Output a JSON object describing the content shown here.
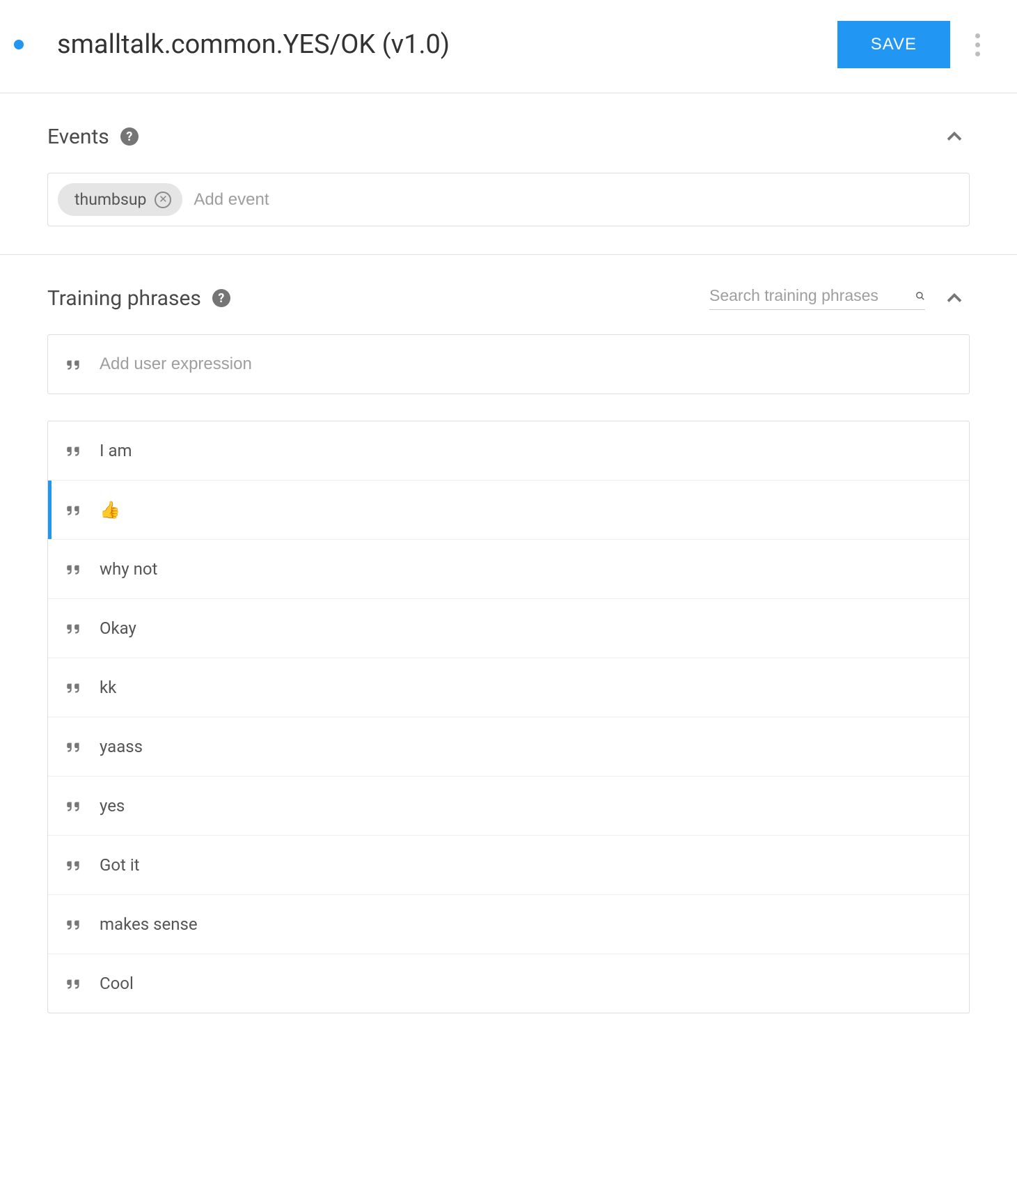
{
  "header": {
    "title": "smalltalk.common.YES/OK (v1.0)",
    "save_label": "SAVE"
  },
  "events": {
    "title": "Events",
    "add_placeholder": "Add event",
    "chips": [
      {
        "label": "thumbsup"
      }
    ]
  },
  "training": {
    "title": "Training phrases",
    "search_placeholder": "Search training phrases",
    "add_placeholder": "Add user expression",
    "phrases": [
      {
        "text": "I am",
        "selected": false
      },
      {
        "text": "👍",
        "selected": true
      },
      {
        "text": "why not",
        "selected": false
      },
      {
        "text": "Okay",
        "selected": false
      },
      {
        "text": "kk",
        "selected": false
      },
      {
        "text": "yaass",
        "selected": false
      },
      {
        "text": "yes",
        "selected": false
      },
      {
        "text": "Got it",
        "selected": false
      },
      {
        "text": "makes sense",
        "selected": false
      },
      {
        "text": "Cool",
        "selected": false
      }
    ]
  }
}
